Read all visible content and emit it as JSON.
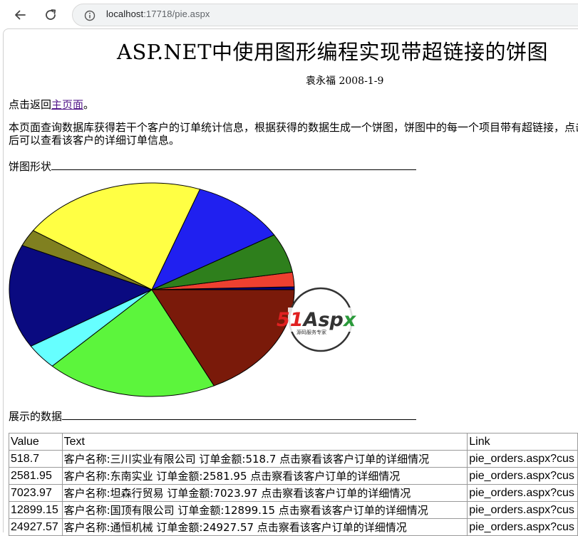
{
  "browser": {
    "url_host": "localhost",
    "url_rest": ":17718/pie.aspx",
    "back_icon": "arrow-left",
    "reload_icon": "reload",
    "info_icon": "info-circle"
  },
  "page": {
    "title": "ASP.NET中使用图形编程实现带超链接的饼图",
    "author": "袁永福 2008-1-9",
    "back_prefix": "点击返回",
    "back_link": "主页面",
    "back_suffix": "。",
    "description": "本页面查询数据库获得若干个客户的订单统计信息，根据获得的数据生成一个饼图，饼图中的每一个项目带有超链接，点击后可以查看该客户的详细订单信息。",
    "pie_section": "饼图形状",
    "data_section": "展示的数据",
    "watermark_text": "51Aspx",
    "watermark_sub": "源码服务专家"
  },
  "chart_data": {
    "type": "pie",
    "slices": [
      {
        "value": 518.7,
        "color": "#000080"
      },
      {
        "value": 2581.95,
        "color": "#ee4030"
      },
      {
        "value": 7023.97,
        "color": "#2e7f1c"
      },
      {
        "value": 12899.15,
        "color": "#2020f0"
      },
      {
        "value": 24927.57,
        "color": "#ffff44"
      },
      {
        "value": 3000,
        "color": "#808020"
      },
      {
        "value": 18500,
        "color": "#0a0a80"
      },
      {
        "value": 4500,
        "color": "#66ffff"
      },
      {
        "value": 23000,
        "color": "#5cf53c"
      },
      {
        "value": 21000,
        "color": "#7a1a0a"
      }
    ],
    "outline_color": "#000000"
  },
  "table": {
    "headers": [
      "Value",
      "Text",
      "Link"
    ],
    "rows": [
      [
        "518.7",
        "客户名称:三川实业有限公司 订单金额:518.7 点击察看该客户订单的详细情况",
        "pie_orders.aspx?cus"
      ],
      [
        "2581.95",
        "客户名称:东南实业 订单金额:2581.95 点击察看该客户订单的详细情况",
        "pie_orders.aspx?cus"
      ],
      [
        "7023.97",
        "客户名称:坦森行贸易 订单金额:7023.97 点击察看该客户订单的详细情况",
        "pie_orders.aspx?cus"
      ],
      [
        "12899.15",
        "客户名称:国顶有限公司 订单金额:12899.15 点击察看该客户订单的详细情况",
        "pie_orders.aspx?cus"
      ],
      [
        "24927.57",
        "客户名称:通恒机械 订单金额:24927.57 点击察看该客户订单的详细情况",
        "pie_orders.aspx?cus"
      ]
    ]
  }
}
